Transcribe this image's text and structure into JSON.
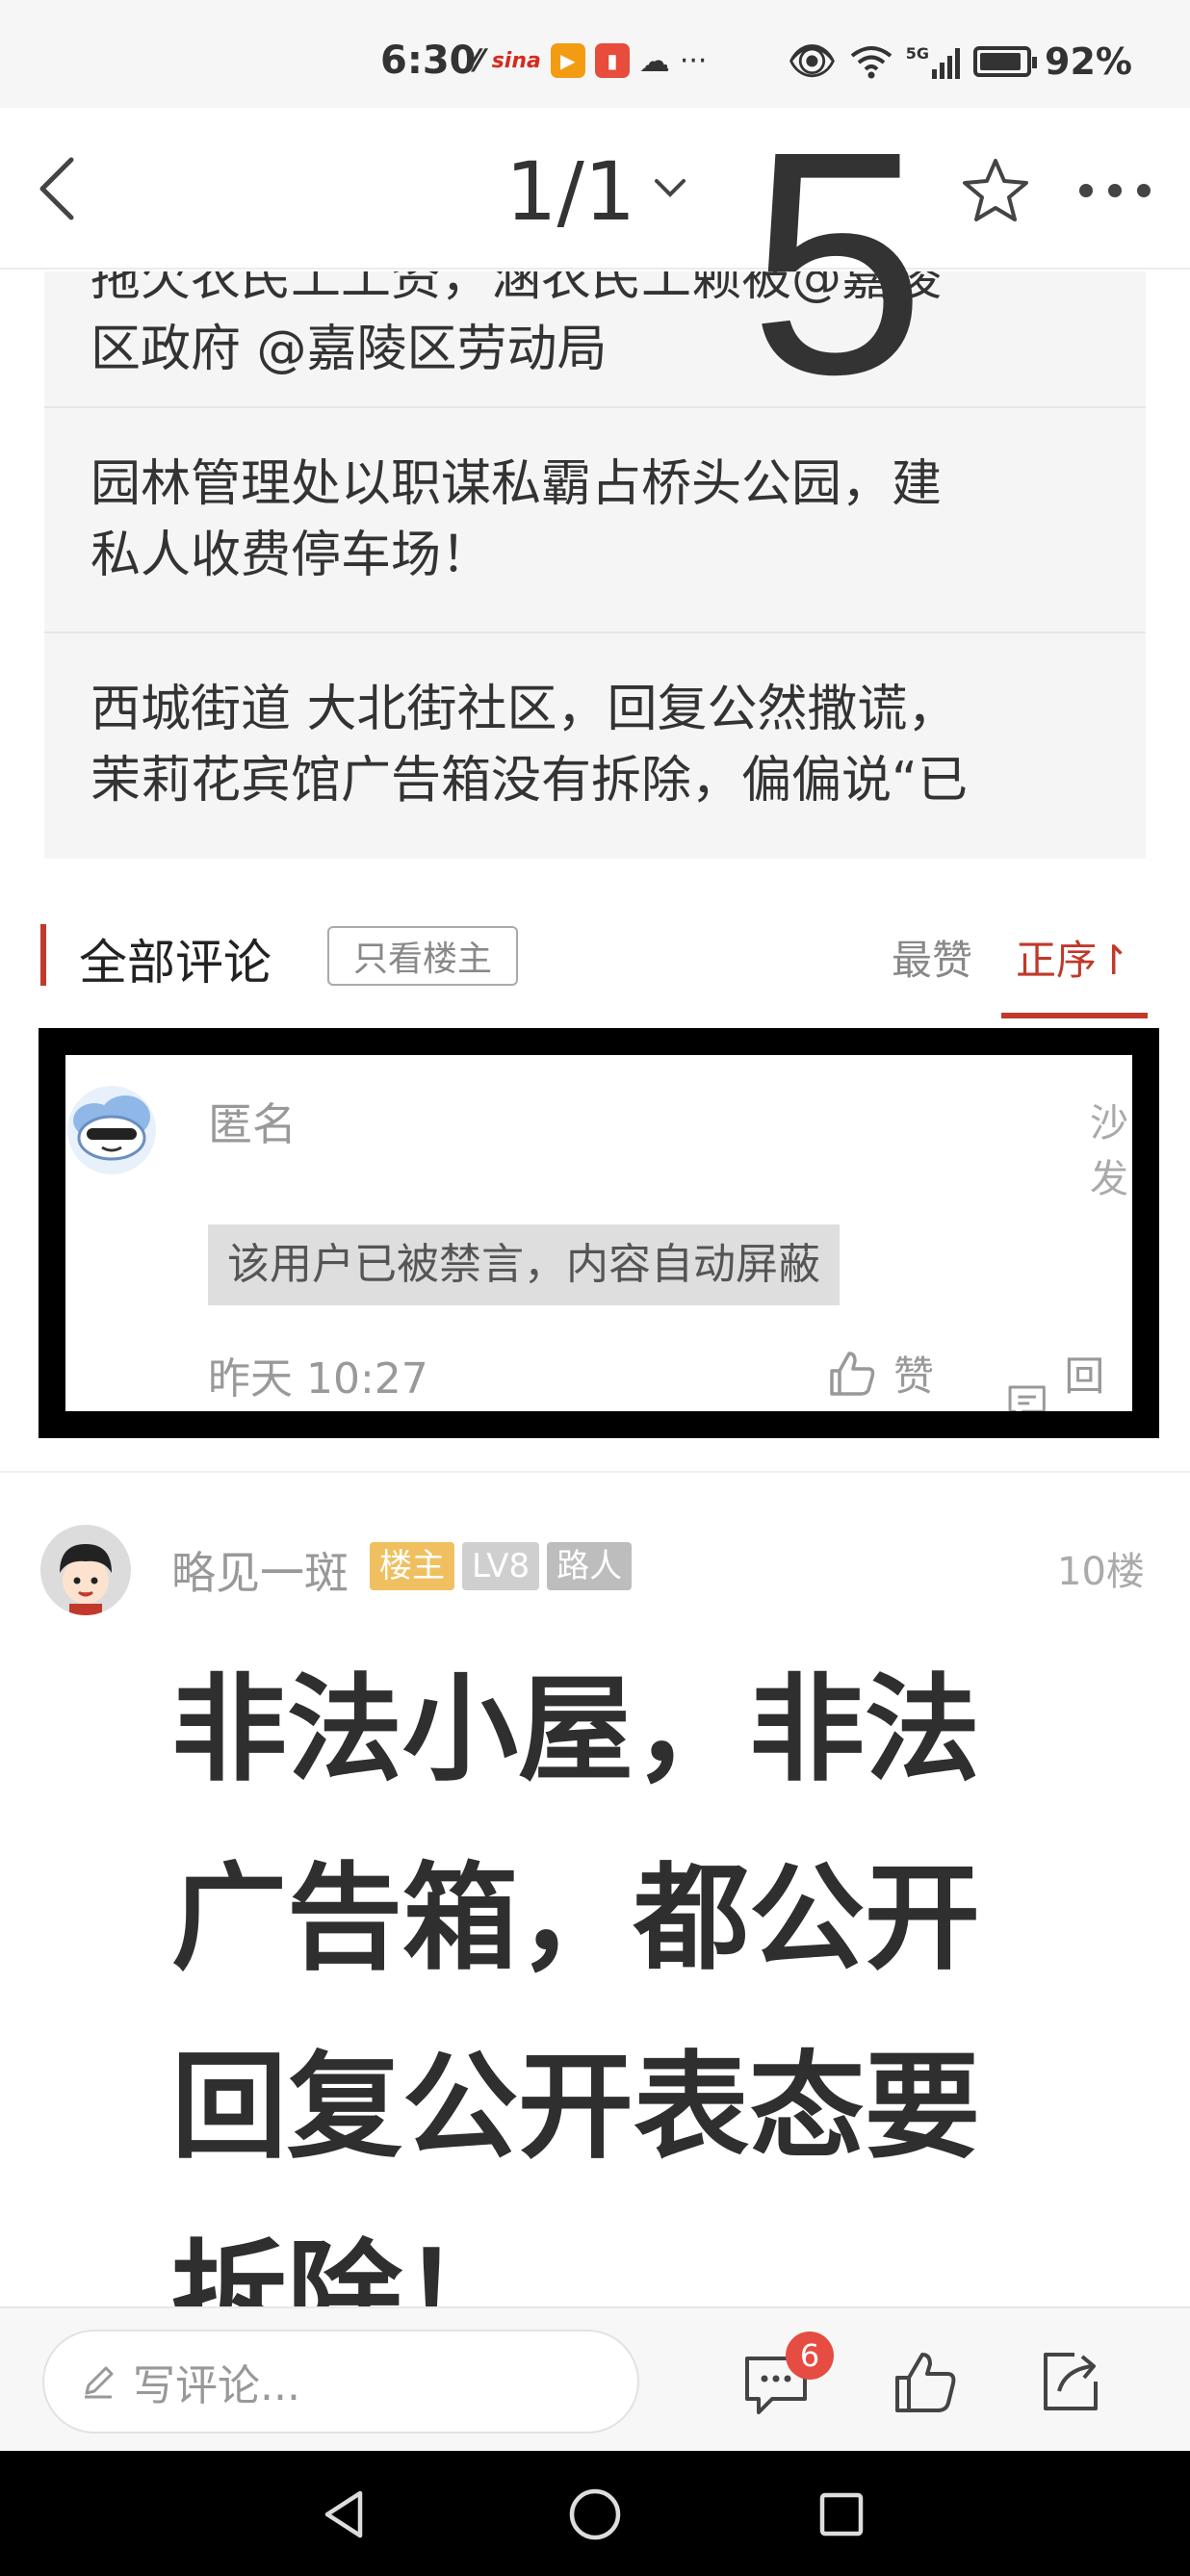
{
  "status_bar": {
    "time": "6:30",
    "network": "5G",
    "battery": "92%"
  },
  "nav": {
    "page_indicator": "1/1",
    "overlay_number": "5"
  },
  "quoted_topics": [
    "拖欠农民工工资，涵农民工赖被@嘉陵",
    "区政府 @嘉陵区劳动局",
    "园林管理处以职谋私霸占桥头公园，建",
    "私人收费停车场！",
    "西城街道 大北街社区，回复公然撒谎，",
    "茉莉花宾馆广告箱没有拆除，偏偏说“已"
  ],
  "comments_header": {
    "title": "全部评论",
    "only_op": "只看楼主",
    "sort_hot": "最赞",
    "sort_order": "正序↾"
  },
  "highlighted_comment": {
    "author": "匿名",
    "floor": "沙发",
    "content": "该用户已被禁言，内容自动屏蔽",
    "time": "昨天 10:27",
    "like_label": "赞",
    "reply_label": "回复"
  },
  "floor_comment": {
    "author": "略见一斑",
    "badges": [
      "楼主",
      "LV8",
      "路人"
    ],
    "floor": "10楼",
    "content_lines": [
      "非法小屋，非法",
      "广告箱，都公开",
      "回复公开表态要",
      "拆除！"
    ]
  },
  "bottom_bar": {
    "placeholder": "写评论...",
    "comment_count": "6"
  },
  "colors": {
    "accent": "#c0392b",
    "badge_op": "#f0c060",
    "badge_gray": "#cfcfcf"
  }
}
